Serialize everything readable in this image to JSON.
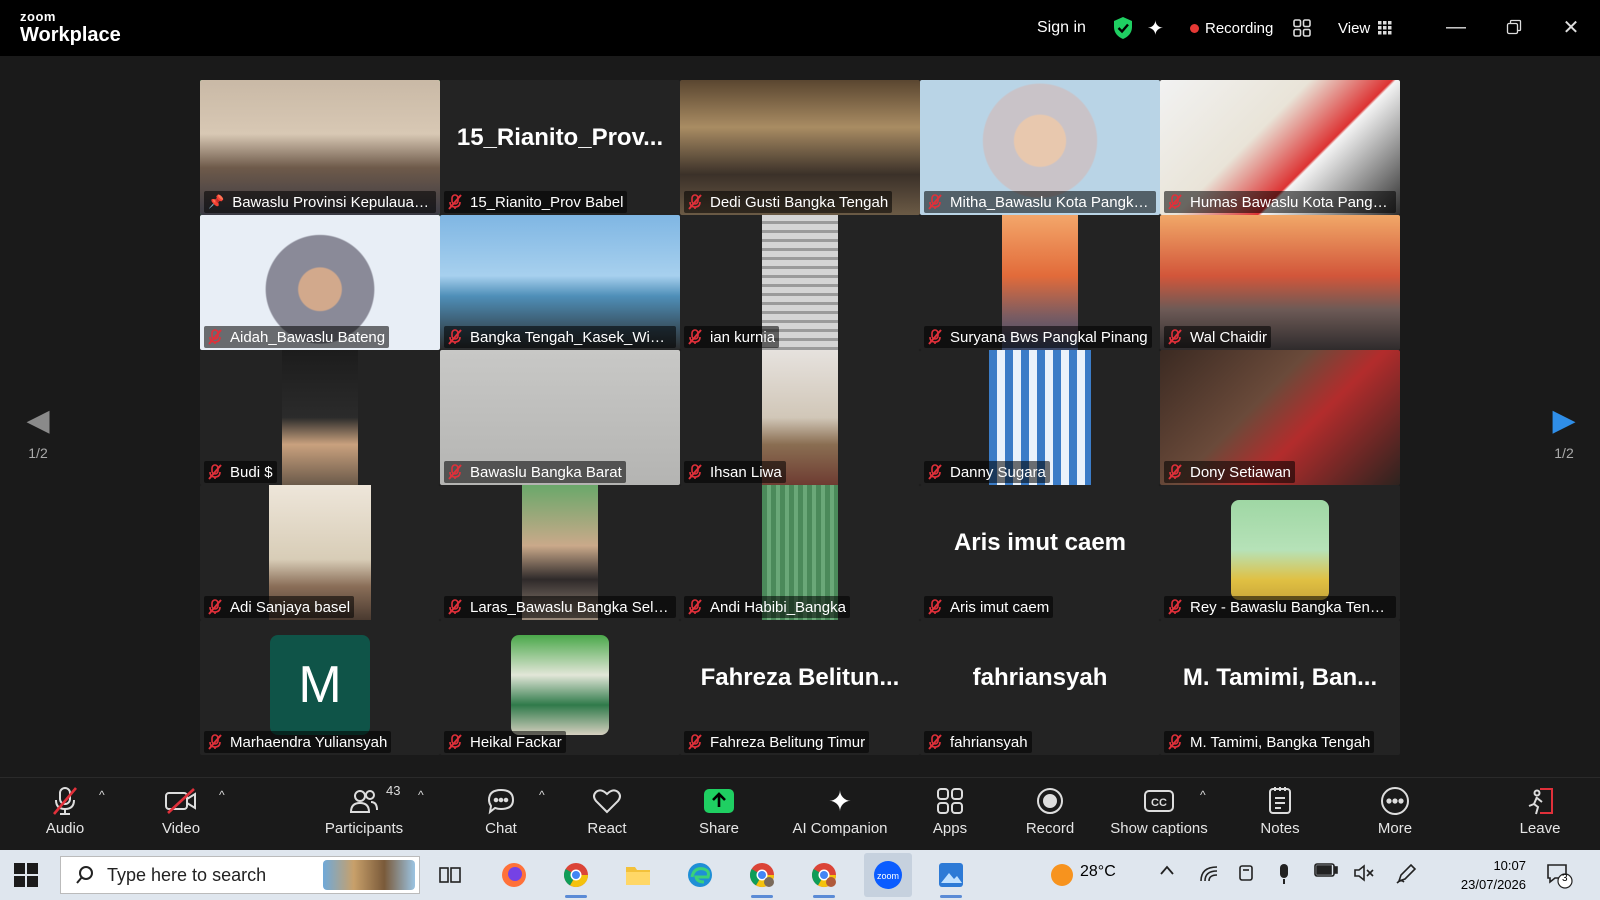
{
  "app": {
    "brand_top": "zoom",
    "brand_bottom": "Workplace"
  },
  "titlebar": {
    "sign_in": "Sign in",
    "recording": "Recording",
    "view": "View"
  },
  "pager": {
    "left": "1/2",
    "right": "1/2"
  },
  "participants": [
    {
      "name": "Bawaslu Provinsi Kepulauan...",
      "kind": "video",
      "bg": "linear-gradient(180deg,#c9b9a6 0%,#d8c8b4 40%,#6e5a4a 65%,#3a3a44 100%)",
      "vw": 240,
      "pinned": true,
      "active": true
    },
    {
      "name": "15_Rianito_Prov Babel",
      "kind": "text",
      "big": "15_Rianito_Prov..."
    },
    {
      "name": "Dedi Gusti Bangka Tengah",
      "kind": "video",
      "bg": "linear-gradient(180deg,#5a4630 0%,#a98c63 35%,#3b3129 70%,#6b5a45 100%)",
      "vw": 240
    },
    {
      "name": "Mitha_Bawaslu Kota Pangka...",
      "kind": "video",
      "bg": "radial-gradient(circle at 50% 45%,#e8c8ae 0 18%,#c9c3c8 19% 40%,#b9d4e6 41% 100%)",
      "vw": 240
    },
    {
      "name": "Humas Bawaslu Kota Pangk...",
      "kind": "video",
      "bg": "linear-gradient(135deg,#f2f2f2 0%,#e9e4d8 40%,#d33 62%,#f4f4f4 63%,#2d2d2d 100%)",
      "vw": 240
    },
    {
      "name": "Aidah_Bawaslu Bateng",
      "kind": "video",
      "bg": "radial-gradient(circle at 50% 55%,#d2a98c 0 15%,#8a8a98 16% 38%,#e8eef6 39% 100%)",
      "vw": 240
    },
    {
      "name": "Bangka Tengah_Kasek_Win I...",
      "kind": "video",
      "bg": "linear-gradient(180deg,#7fb6e3 0%,#a7d0ee 45%,#4f8fb8 60%,#2a2a2a 100%)",
      "vw": 240
    },
    {
      "name": "ian kurnia",
      "kind": "video",
      "bg": "repeating-linear-gradient(180deg,#d5d5d5 0 6px,#9b9b9b 6px 9px)",
      "vw": 76
    },
    {
      "name": "Suryana Bws Pangkal Pinang",
      "kind": "video",
      "bg": "linear-gradient(180deg,#f3a66a 0%,#e26b3a 45%,#7a5c62 75%,#3b4a6a 100%)",
      "vw": 76
    },
    {
      "name": "Wal Chaidir",
      "kind": "video",
      "bg": "linear-gradient(180deg,#f1a868 0%,#d2563a 45%,#6d5a56 70%,#2f2b2c 100%)",
      "vw": 240
    },
    {
      "name": "Budi $",
      "kind": "video",
      "bg": "linear-gradient(180deg,#1c1c1c 0%,#2b2b2b 50%,#c9a17e 70%,#6b5a4a 100%)",
      "vw": 76
    },
    {
      "name": "Bawaslu Bangka Barat",
      "kind": "video",
      "bg": "linear-gradient(180deg,#c8c8c6 0%,#b4b4b2 100%)",
      "vw": 240
    },
    {
      "name": "Ihsan Liwa",
      "kind": "video",
      "bg": "linear-gradient(180deg,#e6e2de 0%,#d1c7b8 50%,#8a6e52 70%,#6e3c32 100%)",
      "vw": 76
    },
    {
      "name": "Danny Sugara",
      "kind": "video",
      "bg": "repeating-linear-gradient(90deg,#3b7cc7 0 8px,#eaf2fb 8px 16px)",
      "vw": 102
    },
    {
      "name": "Dony Setiawan",
      "kind": "video",
      "bg": "linear-gradient(135deg,#3b2a22 0%,#6a4a3a 40%,#b32c2c 60%,#2d231f 100%)",
      "vw": 240
    },
    {
      "name": "Adi Sanjaya basel",
      "kind": "video",
      "bg": "linear-gradient(180deg,#eee6da 0%,#d8cdb7 55%,#8a6e58 75%,#4a3a30 100%)",
      "vw": 102
    },
    {
      "name": "Laras_Bawaslu Bangka Selat...",
      "kind": "video",
      "bg": "linear-gradient(180deg,#6aa86a 0%,#caa98a 45%,#2f2a2a 70%,#9a8a7a 100%)",
      "vw": 76
    },
    {
      "name": "Andi Habibi_Bangka",
      "kind": "video",
      "bg": "repeating-linear-gradient(90deg,#4b8a5a 0 5px,#6aa878 5px 9px)",
      "vw": 76
    },
    {
      "name": "Aris imut caem",
      "kind": "text",
      "big": "Aris imut caem"
    },
    {
      "name": "Rey - Bawaslu Bangka Tengah",
      "kind": "photo",
      "bg": "linear-gradient(180deg,#9fd7a4 0%,#b6e2b8 50%,#e0c043 80%,#caa83a 100%)"
    },
    {
      "name": "Marhaendra Yuliansyah",
      "kind": "avatar",
      "initial": "M"
    },
    {
      "name": "Heikal Fackar",
      "kind": "photo",
      "bg": "linear-gradient(180deg,#4aa84a 0%,#e2e6d8 40%,#2f7a4a 70%,#d6d0c0 100%)"
    },
    {
      "name": "Fahreza Belitung Timur",
      "kind": "text",
      "big": "Fahreza  Belitun..."
    },
    {
      "name": "fahriansyah",
      "kind": "text",
      "big": "fahriansyah"
    },
    {
      "name": "M. Tamimi, Bangka Tengah",
      "kind": "text",
      "big": "M. Tamimi, Ban..."
    }
  ],
  "toolbar": {
    "audio": "Audio",
    "video": "Video",
    "participants": "Participants",
    "participants_count": "43",
    "chat": "Chat",
    "react": "React",
    "share": "Share",
    "ai": "AI Companion",
    "apps": "Apps",
    "record": "Record",
    "captions": "Show captions",
    "notes": "Notes",
    "more": "More",
    "leave": "Leave"
  },
  "taskbar": {
    "search_placeholder": "Type here to search",
    "temperature": "28°C",
    "time": "10:07",
    "date": "23/07/2026",
    "notifications": "3"
  },
  "colors": {
    "share_green": "#1fcf62",
    "active_border": "#23d959",
    "muted_red": "#e0303a",
    "recording_red": "#e53935"
  }
}
